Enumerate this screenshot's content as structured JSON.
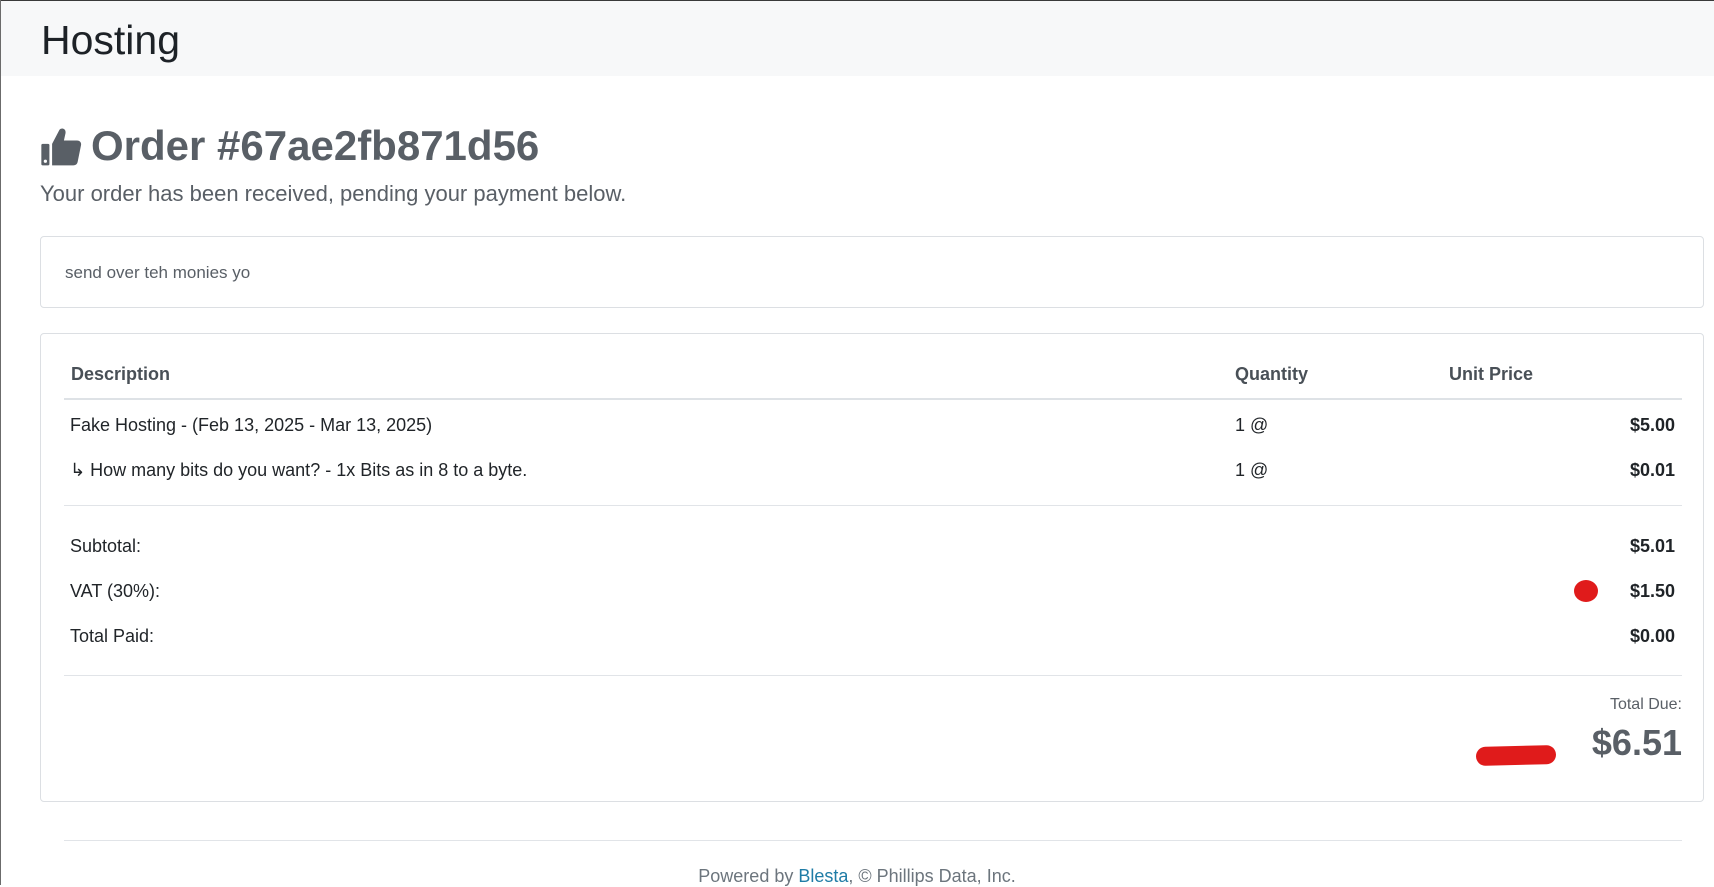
{
  "header": {
    "title": "Hosting"
  },
  "order": {
    "icon": "thumbs-up-icon",
    "title": "Order #67ae2fb871d56",
    "subtitle": "Your order has been received, pending your payment below."
  },
  "notice": {
    "text": "send over teh monies yo"
  },
  "invoice": {
    "columns": [
      "Description",
      "Quantity",
      "Unit Price"
    ],
    "line_items": [
      {
        "description": "Fake Hosting - (Feb 13, 2025 - Mar 13, 2025)",
        "quantity": "1 @",
        "amount": "$5.00"
      },
      {
        "description": "↳ How many bits do you want? - 1x Bits as in 8 to a byte.",
        "quantity": "1 @",
        "amount": "$0.01"
      }
    ],
    "summary": [
      {
        "label": "Subtotal:",
        "amount": "$5.01"
      },
      {
        "label": "VAT (30%):",
        "amount": "$1.50"
      },
      {
        "label": "Total Paid:",
        "amount": "$0.00"
      }
    ],
    "total_due_label": "Total Due:",
    "total_due_amount": "$6.51"
  },
  "footer": {
    "prefix": "Powered by ",
    "link_text": "Blesta",
    "suffix": ", © Phillips Data, Inc."
  },
  "colors": {
    "header_bg": "#f7f8f9",
    "text_muted": "#595f66",
    "link": "#1f7ca6",
    "annotation_red": "#e01b1b"
  }
}
